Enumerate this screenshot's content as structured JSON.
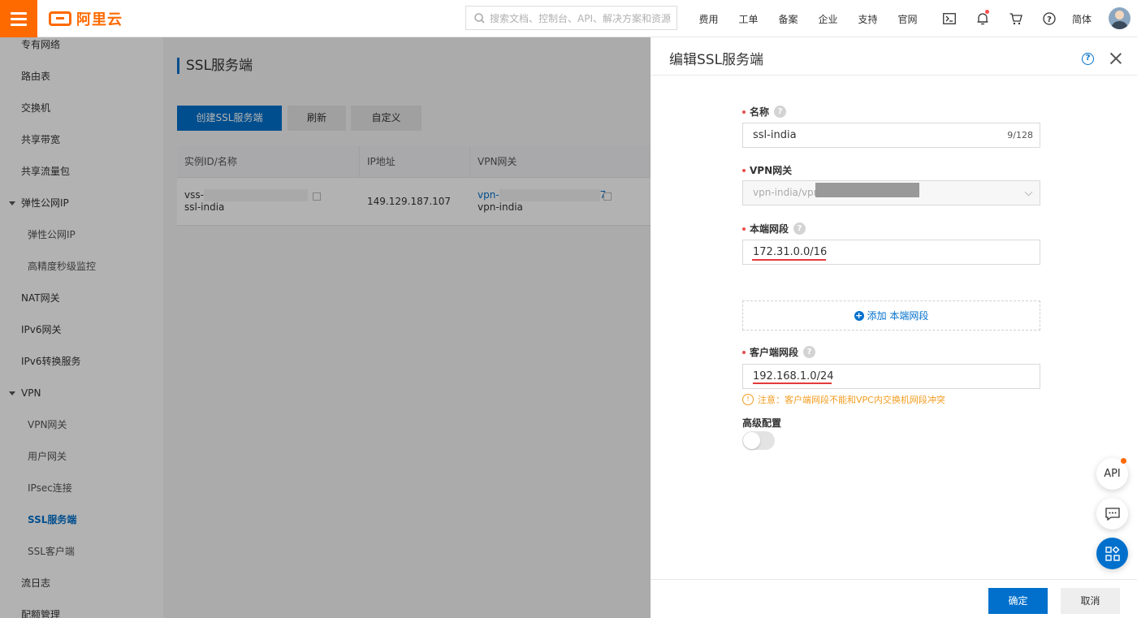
{
  "header": {
    "logo_text": "阿里云",
    "search_placeholder": "搜索文档、控制台、API、解决方案和资源",
    "nav": [
      "费用",
      "工单",
      "备案",
      "企业",
      "支持",
      "官网"
    ],
    "lang": "简体"
  },
  "sidebar": {
    "items": [
      {
        "label": "专有网络"
      },
      {
        "label": "路由表"
      },
      {
        "label": "交换机"
      },
      {
        "label": "共享带宽"
      },
      {
        "label": "共享流量包"
      },
      {
        "label": "弹性公网IP"
      },
      {
        "label": "弹性公网IP"
      },
      {
        "label": "高精度秒级监控"
      },
      {
        "label": "NAT网关"
      },
      {
        "label": "IPv6网关"
      },
      {
        "label": "IPv6转换服务"
      },
      {
        "label": "VPN"
      },
      {
        "label": "VPN网关"
      },
      {
        "label": "用户网关"
      },
      {
        "label": "IPsec连接"
      },
      {
        "label": "SSL服务端"
      },
      {
        "label": "SSL客户端"
      },
      {
        "label": "流日志"
      },
      {
        "label": "配额管理"
      }
    ]
  },
  "main": {
    "title": "SSL服务端",
    "buttons": {
      "create": "创建SSL服务端",
      "refresh": "刷新",
      "custom": "自定义"
    },
    "columns": [
      "实例ID/名称",
      "IP地址",
      "VPN网关"
    ],
    "row": {
      "id": "vss-",
      "name": "ssl-india",
      "ip": "149.129.187.107",
      "vpn_id": "vpn-",
      "vpn_id_tail": "7",
      "vpn_name": "vpn-india"
    }
  },
  "drawer": {
    "title": "编辑SSL服务端",
    "name_label": "名称",
    "name_value": "ssl-india",
    "name_count": "9/128",
    "vpn_label": "VPN网关",
    "vpn_value": "vpn-india/vpn-",
    "local_label": "本端网段",
    "local_value": "172.31.0.0/16",
    "add_local": "添加 本端网段",
    "client_label": "客户端网段",
    "client_value": "192.168.1.0/24",
    "warning": "注意：客户端网段不能和VPC内交换机网段冲突",
    "advanced_label": "高级配置",
    "advanced_enabled": false,
    "ok": "确定",
    "cancel": "取消"
  },
  "floating": {
    "api": "API"
  },
  "colors": {
    "brand": "#ff6a00",
    "primary": "#0070cc",
    "required": "#e84e4e",
    "warning": "#f29c1f",
    "annotation": "#e43a3a"
  }
}
